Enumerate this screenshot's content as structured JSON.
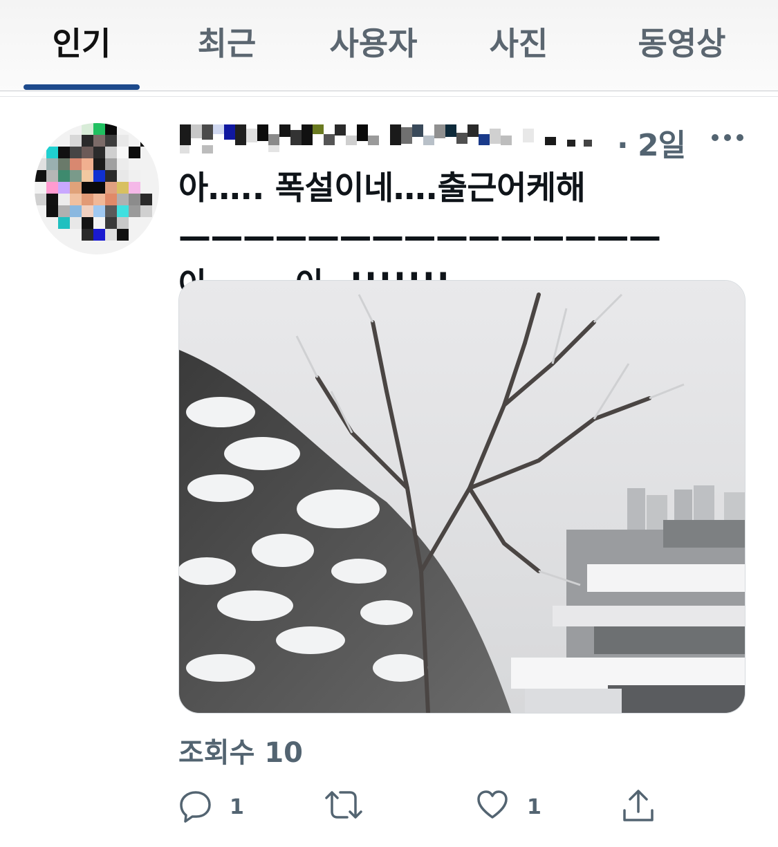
{
  "tabs": [
    {
      "label": "인기",
      "active": true
    },
    {
      "label": "최근",
      "active": false
    },
    {
      "label": "사용자",
      "active": false
    },
    {
      "label": "사진",
      "active": false
    },
    {
      "label": "동영상",
      "active": false
    }
  ],
  "tweet": {
    "time": "· 2일",
    "text": "아….. 폭설이네….출근어케해 ——————————————— 아……. 아..!!!!!!!",
    "views": "조회수 10",
    "actions": {
      "reply_count": "1",
      "like_count": "1"
    }
  },
  "icons": {
    "more": "more-horizontal-icon",
    "reply": "reply-bubble-icon",
    "retweet": "retweet-icon",
    "like": "heart-icon",
    "share": "share-upload-icon"
  },
  "colors": {
    "accent": "#1d4a8c",
    "muted": "#536471",
    "text": "#0f1419"
  }
}
